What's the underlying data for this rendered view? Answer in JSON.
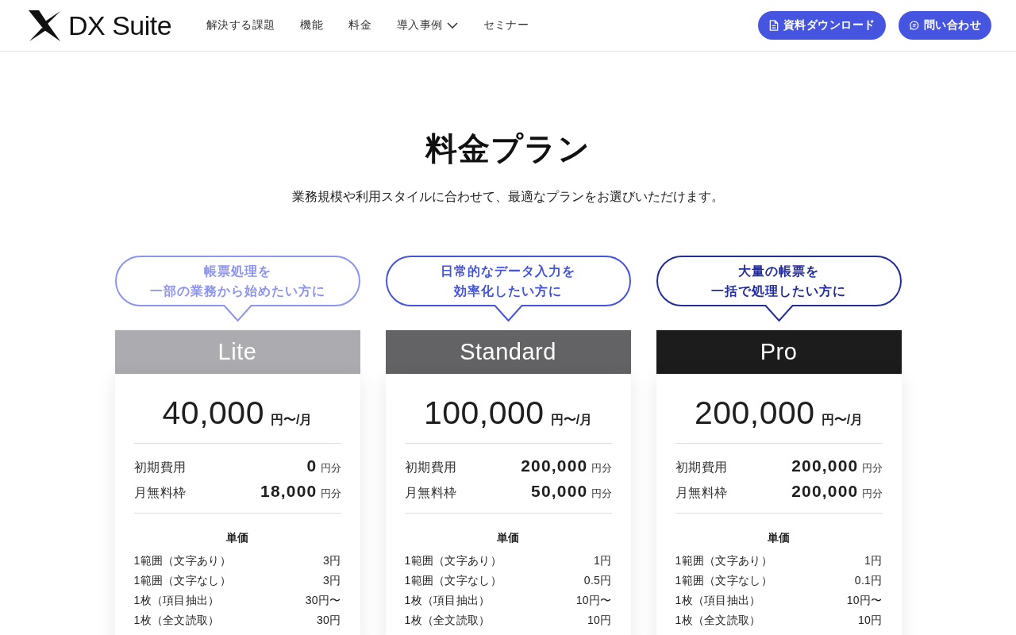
{
  "header": {
    "logo": "DX Suite",
    "nav": [
      {
        "label": "解決する課題",
        "dropdown": false
      },
      {
        "label": "機能",
        "dropdown": false
      },
      {
        "label": "料金",
        "dropdown": false
      },
      {
        "label": "導入事例",
        "dropdown": true
      },
      {
        "label": "セミナー",
        "dropdown": false
      }
    ],
    "buttons": [
      {
        "label": "資料ダウンロード",
        "kind": "document"
      },
      {
        "label": "問い合わせ",
        "kind": "chat"
      }
    ]
  },
  "pricing": {
    "title": "料金プラン",
    "subtitle": "業務規模や利用スタイルに合わせて、最適なプランをお選びいただけます。",
    "plans": [
      {
        "bubble_lines": [
          "帳票処理を",
          "一部の業務から始めたい方に"
        ],
        "color": "#8c94ef",
        "name": "Lite",
        "price": "40,000",
        "price_unit": "円〜/月",
        "fees": [
          {
            "label": "初期費用",
            "value": "0",
            "unit": "円分"
          },
          {
            "label": "月無料枠",
            "value": "18,000",
            "unit": "円分"
          }
        ],
        "unit_price_heading": "単価",
        "unit_prices": [
          {
            "label": "1範囲（文字あり）",
            "value": "3円"
          },
          {
            "label": "1範囲（文字なし）",
            "value": "3円"
          },
          {
            "label": "1枚（項目抽出）",
            "value": "30円〜"
          },
          {
            "label": "1枚（全文読取）",
            "value": "30円"
          }
        ]
      },
      {
        "bubble_lines": [
          "日常的なデータ入力を",
          "効率化したい方に"
        ],
        "color": "#4453de",
        "name": "Standard",
        "price": "100,000",
        "price_unit": "円〜/月",
        "fees": [
          {
            "label": "初期費用",
            "value": "200,000",
            "unit": "円分"
          },
          {
            "label": "月無料枠",
            "value": "50,000",
            "unit": "円分"
          }
        ],
        "unit_price_heading": "単価",
        "unit_prices": [
          {
            "label": "1範囲（文字あり）",
            "value": "1円"
          },
          {
            "label": "1範囲（文字なし）",
            "value": "0.5円"
          },
          {
            "label": "1枚（項目抽出）",
            "value": "10円〜"
          },
          {
            "label": "1枚（全文読取）",
            "value": "10円"
          }
        ]
      },
      {
        "bubble_lines": [
          "大量の帳票を",
          "一括で処理したい方に"
        ],
        "color": "#222c9a",
        "name": "Pro",
        "price": "200,000",
        "price_unit": "円〜/月",
        "fees": [
          {
            "label": "初期費用",
            "value": "200,000",
            "unit": "円分"
          },
          {
            "label": "月無料枠",
            "value": "200,000",
            "unit": "円分"
          }
        ],
        "unit_price_heading": "単価",
        "unit_prices": [
          {
            "label": "1範囲（文字あり）",
            "value": "1円"
          },
          {
            "label": "1範囲（文字なし）",
            "value": "0.1円"
          },
          {
            "label": "1枚（項目抽出）",
            "value": "10円〜"
          },
          {
            "label": "1枚（全文読取）",
            "value": "10円"
          }
        ]
      }
    ]
  }
}
